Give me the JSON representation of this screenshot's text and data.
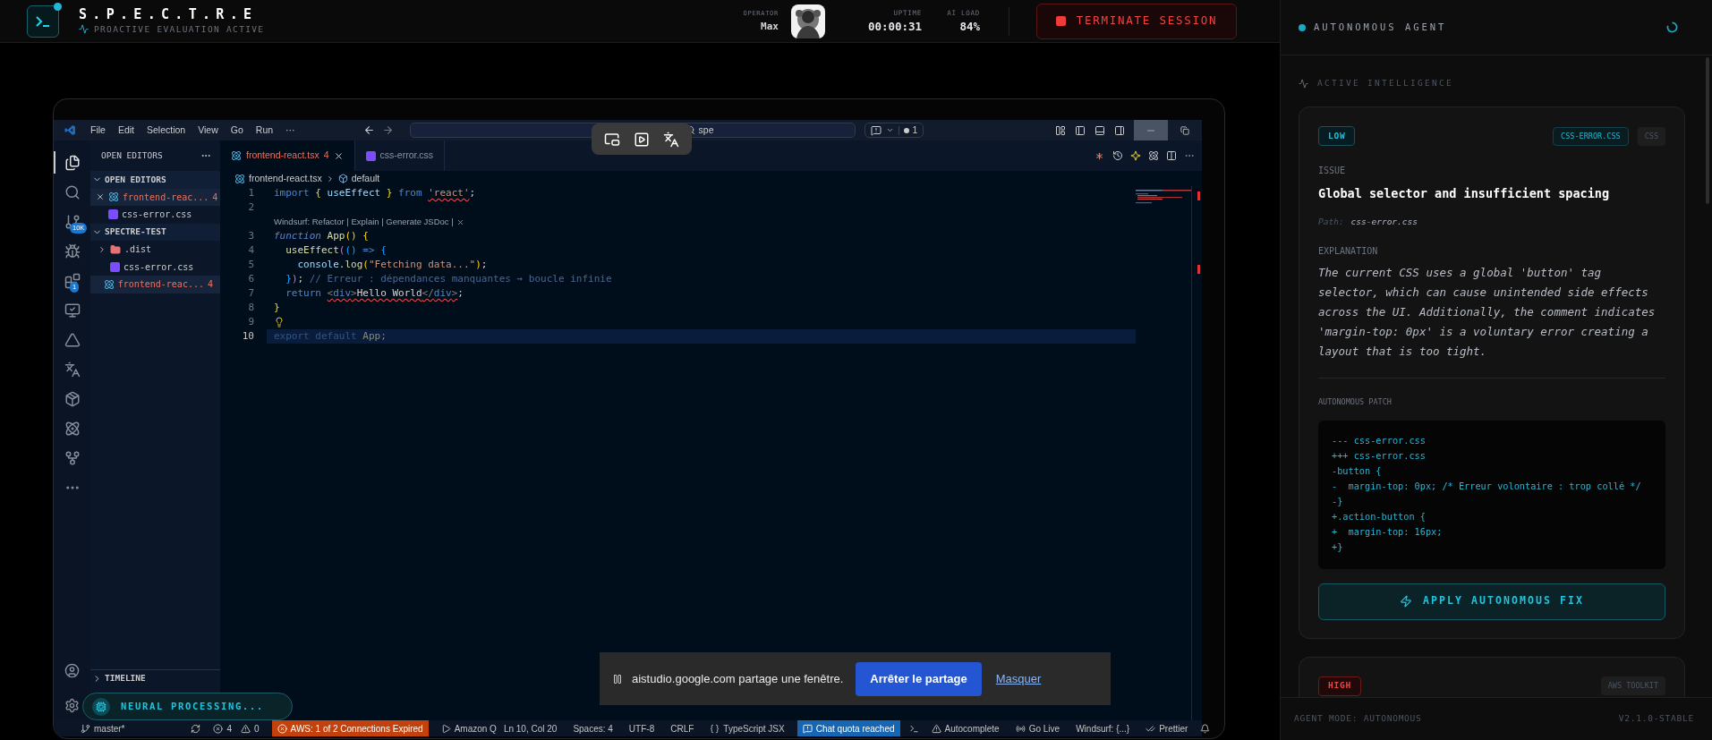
{
  "header": {
    "title": "S.P.E.C.T.R.E",
    "subtitle": "PROACTIVE EVALUATION ACTIVE",
    "operator_label": "OPERATOR",
    "operator": "Max",
    "stats": [
      {
        "label": "UPTIME",
        "value": "00:00:31"
      },
      {
        "label": "AI LOAD",
        "value": "84%"
      }
    ],
    "terminate_button": "TERMINATE SESSION"
  },
  "vscode": {
    "menu": [
      "File",
      "Edit",
      "Selection",
      "View",
      "Go",
      "Run",
      "···"
    ],
    "search": {
      "value": "spe"
    },
    "notifications": "1",
    "activity": [
      {
        "kind": "explorer",
        "selected": true
      },
      {
        "kind": "search",
        "selected": false
      },
      {
        "kind": "source-control",
        "badge": "10K",
        "selected": false
      },
      {
        "kind": "debug",
        "selected": false
      },
      {
        "kind": "extensions",
        "badge": "1",
        "selected": false
      },
      {
        "kind": "remote",
        "selected": false
      },
      {
        "kind": "triangle",
        "selected": false
      },
      {
        "kind": "translate",
        "selected": false
      },
      {
        "kind": "package",
        "selected": false
      },
      {
        "kind": "atom",
        "selected": false
      },
      {
        "kind": "fork",
        "selected": false
      },
      {
        "kind": "more",
        "selected": false
      }
    ],
    "sidebar": {
      "title": "OPEN EDITORS",
      "sections": [
        {
          "title": "OPEN EDITORS",
          "expanded": true,
          "items": [
            {
              "name": "frontend-reac...",
              "kind": "react",
              "problems": "4",
              "close": true,
              "selected": true
            },
            {
              "name": "css-error.css",
              "kind": "css",
              "close": false,
              "selected": false
            }
          ]
        },
        {
          "title": "SPECTRE-TEST",
          "expanded": true,
          "items": [
            {
              "name": ".dist",
              "kind": "folder",
              "expanded": false,
              "close": false,
              "selected": false
            },
            {
              "name": "css-error.css",
              "kind": "css",
              "close": false,
              "selected": false
            },
            {
              "name": "frontend-reac...",
              "kind": "react",
              "problems": "4",
              "close": false,
              "selected": true
            }
          ]
        }
      ],
      "timeline": "TIMELINE"
    },
    "tabs": [
      {
        "label": "frontend-react.tsx",
        "kind": "react",
        "problems": "4",
        "selected": true
      },
      {
        "label": "css-error.css",
        "kind": "css",
        "selected": false
      }
    ],
    "breadcrumb": [
      {
        "text": "frontend-react.tsx",
        "kind": "react"
      },
      {
        "text": "default",
        "kind": "symbol"
      }
    ],
    "lines": [
      {
        "number": "1",
        "selected": false,
        "tokens": [
          {
            "text": "import ",
            "kind": "keyword"
          },
          {
            "text": "{",
            "kind": "bracket1"
          },
          {
            "text": " useEffect ",
            "kind": "ident"
          },
          {
            "text": "}",
            "kind": "bracket1"
          },
          {
            "text": " from ",
            "kind": "keyword"
          },
          {
            "text": "'react'",
            "kind": "string",
            "squiggle": true
          },
          {
            "text": ";",
            "kind": "punct"
          }
        ]
      },
      {
        "number": "2",
        "selected": false
      },
      {
        "number": "3",
        "selected": false,
        "codelens": "Windsurf: Refactor | Explain | Generate JSDoc |",
        "tokens": [
          {
            "text": "function",
            "kind": "storage"
          },
          {
            "text": " App",
            "kind": "fn"
          },
          {
            "text": "()",
            "kind": "bracket1"
          },
          {
            "text": " {",
            "kind": "bracket1"
          }
        ]
      },
      {
        "number": "4",
        "selected": false,
        "tokens": [
          {
            "text": "  useEffect",
            "kind": "fn"
          },
          {
            "text": "(",
            "kind": "bracket2"
          },
          {
            "text": "()",
            "kind": "bracket3"
          },
          {
            "text": " => ",
            "kind": "keyword"
          },
          {
            "text": "{",
            "kind": "bracket3"
          }
        ]
      },
      {
        "number": "5",
        "selected": false,
        "tokens": [
          {
            "text": "    console",
            "kind": "ident"
          },
          {
            "text": ".",
            "kind": "punct"
          },
          {
            "text": "log",
            "kind": "fn"
          },
          {
            "text": "(",
            "kind": "bracket1"
          },
          {
            "text": "\"Fetching data...\"",
            "kind": "string"
          },
          {
            "text": ")",
            "kind": "bracket1"
          },
          {
            "text": ";",
            "kind": "punct"
          }
        ]
      },
      {
        "number": "6",
        "selected": false,
        "tokens": [
          {
            "text": "  }",
            "kind": "bracket3"
          },
          {
            "text": ")",
            "kind": "bracket2"
          },
          {
            "text": ";",
            "kind": "punct"
          },
          {
            "text": " // Erreur : dépendances manquantes → boucle infinie",
            "kind": "comment"
          }
        ]
      },
      {
        "number": "7",
        "selected": false,
        "tokens": [
          {
            "text": "  return ",
            "kind": "keyword"
          },
          {
            "text": "<",
            "kind": "tagpunct",
            "squiggle": true
          },
          {
            "text": "div",
            "kind": "tag",
            "squiggle": true
          },
          {
            "text": ">",
            "kind": "tagpunct",
            "squiggle": true
          },
          {
            "text": "Hello World",
            "kind": "text",
            "squiggle": true
          },
          {
            "text": "</",
            "kind": "tagpunct",
            "squiggle": true
          },
          {
            "text": "div",
            "kind": "tag",
            "squiggle": true
          },
          {
            "text": ">",
            "kind": "tagpunct",
            "squiggle": true
          },
          {
            "text": ";",
            "kind": "punct"
          }
        ]
      },
      {
        "number": "8",
        "selected": false,
        "tokens": [
          {
            "text": "}",
            "kind": "bracket1"
          }
        ]
      },
      {
        "number": "9",
        "selected": false,
        "lightbulb": true
      },
      {
        "number": "10",
        "selected": true,
        "tokens": [
          {
            "text": "export default ",
            "kind": "keyword"
          },
          {
            "text": "App",
            "kind": "fn"
          },
          {
            "text": ";",
            "kind": "punct"
          }
        ]
      }
    ],
    "status_left": [
      {
        "text": "master*",
        "kind": "branch"
      },
      {
        "text": "4",
        "kind": "errors"
      },
      {
        "text": "0",
        "kind": "warnings"
      },
      {
        "text": "AWS: 1 of 2 Connections Expired",
        "kind": "alert"
      },
      {
        "text": "Amazon Q",
        "kind": "play"
      }
    ],
    "status_right": [
      {
        "text": "Ln 10, Col 20",
        "kind": "plain"
      },
      {
        "text": "Spaces: 4",
        "kind": "plain"
      },
      {
        "text": "UTF-8",
        "kind": "plain"
      },
      {
        "text": "CRLF",
        "kind": "plain"
      },
      {
        "text": "TypeScript JSX",
        "kind": "braces"
      },
      {
        "text": "Chat quota reached",
        "kind": "highlight"
      },
      {
        "text": "Autocomplete",
        "kind": "warning"
      },
      {
        "text": "Go Live",
        "kind": "broadcast"
      },
      {
        "text": "Windsurf: {...}",
        "kind": "plain"
      },
      {
        "text": "Prettier",
        "kind": "checks"
      }
    ]
  },
  "share_bar": {
    "message": "aistudio.google.com partage une fenêtre.",
    "stop_button": "Arrêter le partage",
    "hide_link": "Masquer"
  },
  "processing": "NEURAL PROCESSING...",
  "agent": {
    "title": "AUTONOMOUS AGENT",
    "section_title": "ACTIVE INTELLIGENCE",
    "issues": [
      {
        "kind": "low",
        "severity": "LOW",
        "tags": [
          {
            "text": "CSS-ERROR.CSS",
            "kind": "file"
          },
          {
            "text": "CSS",
            "kind": "plain"
          }
        ],
        "issue_label": "ISSUE",
        "title": "Global selector and insufficient spacing",
        "path_label": "Path:",
        "path": "css-error.css",
        "explanation_label": "EXPLANATION",
        "explanation": "The current CSS uses a global 'button' tag selector, which can cause unintended side effects across the UI. Additionally, the comment indicates 'margin-top: 0px' is a voluntary error creating a layout that is too tight.",
        "patch_label": "AUTONOMOUS PATCH",
        "patch": [
          "--- css-error.css",
          "+++ css-error.css",
          "-button {",
          "-  margin-top: 0px; /* Erreur volontaire : trop collé */",
          "-}",
          "+.action-button {",
          "+  margin-top: 16px;",
          "+}"
        ],
        "apply_button": "APPLY AUTONOMOUS FIX"
      },
      {
        "kind": "high",
        "severity": "HIGH",
        "tags": [
          {
            "text": "AWS TOOLKIT",
            "kind": "plain"
          }
        ]
      }
    ],
    "footer_mode": "AGENT MODE: AUTONOMOUS",
    "version": "V2.1.0-STABLE"
  }
}
